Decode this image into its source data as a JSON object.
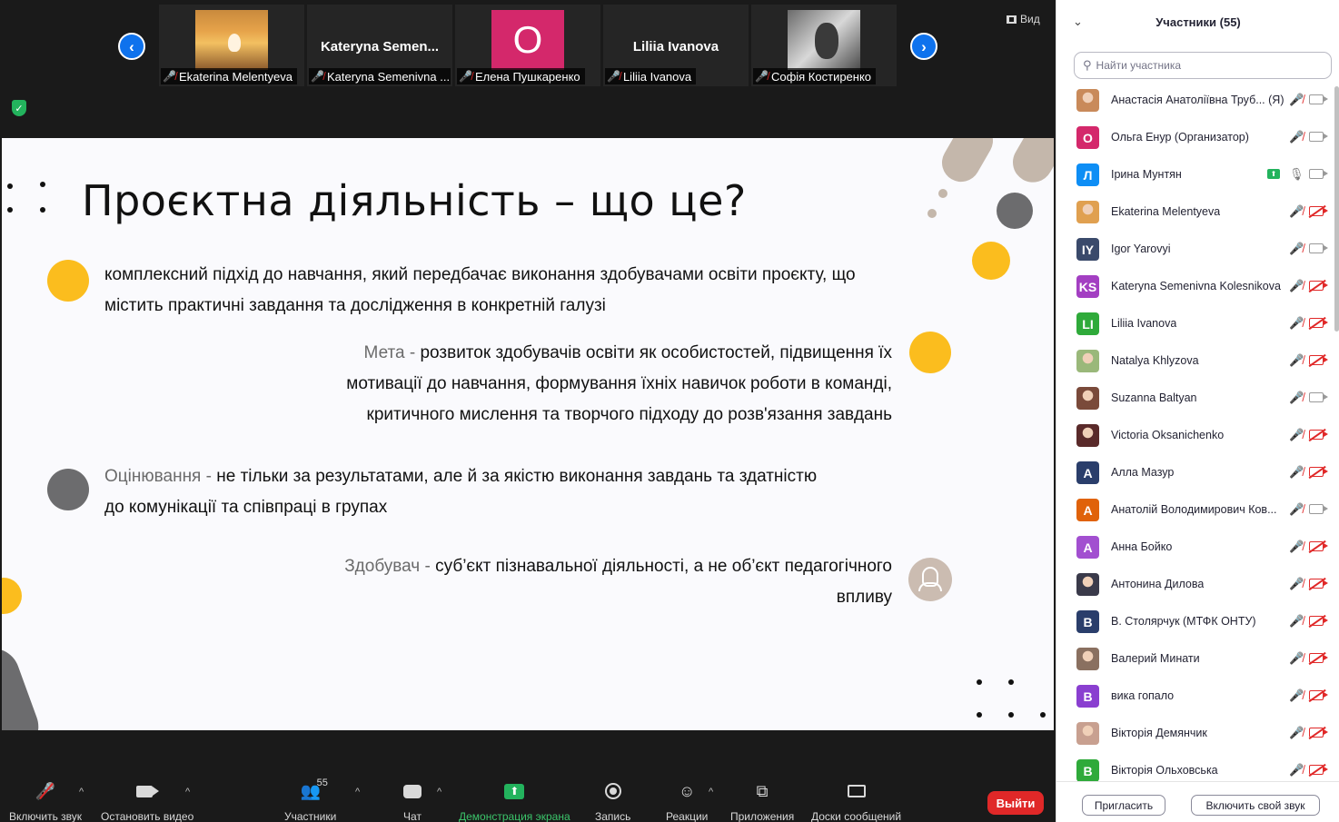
{
  "strip": {
    "view_label": "Вид",
    "thumbnails": [
      {
        "name": "",
        "label": "Ekaterina Melentyeva"
      },
      {
        "name": "Kateryna  Semen...",
        "label": "Kateryna Semenivna ..."
      },
      {
        "name": "",
        "label": "Елена Пушкаренко",
        "initial": "О"
      },
      {
        "name": "Liliia Ivanova",
        "label": "Liliia Ivanova"
      },
      {
        "name": "",
        "label": "Софія Костиренко"
      }
    ]
  },
  "slide": {
    "title": "Проєктна діяльність – що це?",
    "para1": "комплексний підхід до навчання, який передбачає виконання здобувачами освіти проєкту, що містить практичні завдання та дослідження в конкретній галузі",
    "para2_term": "Мета - ",
    "para2_text": "розвиток здобувачів освіти як особистостей, підвищення їх мотивації до навчання, формування їхніх навичок роботи в команді, критичного мислення та творчого підходу до розв'язання завдань",
    "para3_term": "Оцінювання - ",
    "para3_text": "не тільки за результатами, але й за якістю виконання завдань та здатністю до комунікації та співпраці в групах",
    "para4_term": "Здобувач - ",
    "para4_text": "суб’єкт пізнавальної діяльності, а не об’єкт педагогічного впливу"
  },
  "toolbar": {
    "unmute": "Включить звук",
    "stop_video": "Остановить видео",
    "participants": "Участники",
    "participants_count": "55",
    "chat": "Чат",
    "share": "Демонстрация экрана",
    "record": "Запись",
    "reactions": "Реакции",
    "apps": "Приложения",
    "whiteboards": "Доски сообщений",
    "leave": "Выйти"
  },
  "panel": {
    "title": "Участники (55)",
    "search_placeholder": "Найти участника",
    "invite": "Пригласить",
    "unmute_self": "Включить свой звук",
    "participants": [
      {
        "name": "Анастасія Анатоліївна Труб... (Я)",
        "initial": "",
        "color": "#c98a5a",
        "photo": true,
        "cam": "on",
        "mic": "off"
      },
      {
        "name": "Ольга Енур (Организатор)",
        "initial": "О",
        "color": "#d4286b",
        "photo": false,
        "cam": "on",
        "mic": "off"
      },
      {
        "name": "Ірина Мунтян",
        "initial": "Л",
        "color": "#0e8ef5",
        "photo": false,
        "cam": "on",
        "mic": "on",
        "share": true
      },
      {
        "name": "Ekaterina Melentyeva",
        "initial": "",
        "color": "#e0a050",
        "photo": true,
        "cam": "off",
        "mic": "off"
      },
      {
        "name": "Igor Yarovyi",
        "initial": "IY",
        "color": "#3a4a6b",
        "photo": false,
        "cam": "on",
        "mic": "off"
      },
      {
        "name": "Kateryna Semenivna Kolesnikova",
        "initial": "KS",
        "color": "#a33fc2",
        "photo": false,
        "cam": "off",
        "mic": "off"
      },
      {
        "name": "Liliia Ivanova",
        "initial": "LI",
        "color": "#2faa3a",
        "photo": false,
        "cam": "off",
        "mic": "off"
      },
      {
        "name": "Natalya Khlyzova",
        "initial": "",
        "color": "#9ab87a",
        "photo": true,
        "cam": "off",
        "mic": "off"
      },
      {
        "name": "Suzanna Baltyan",
        "initial": "",
        "color": "#7a4a3a",
        "photo": true,
        "cam": "on",
        "mic": "off"
      },
      {
        "name": "Victoria Oksanichenko",
        "initial": "",
        "color": "#5a2a2a",
        "photo": true,
        "cam": "off",
        "mic": "off"
      },
      {
        "name": "Алла Мазур",
        "initial": "А",
        "color": "#2a3e6b",
        "photo": false,
        "cam": "off",
        "mic": "off"
      },
      {
        "name": "Анатолій Володимирович Ков...",
        "initial": "А",
        "color": "#e0620a",
        "photo": false,
        "cam": "on",
        "mic": "off"
      },
      {
        "name": "Анна Бойко",
        "initial": "А",
        "color": "#a24fd0",
        "photo": false,
        "cam": "off",
        "mic": "off"
      },
      {
        "name": "Антонина Дилова",
        "initial": "",
        "color": "#3a3a4a",
        "photo": true,
        "cam": "off",
        "mic": "off"
      },
      {
        "name": "В. Столярчук (МТФК ОНТУ)",
        "initial": "В",
        "color": "#2a3e6b",
        "photo": false,
        "cam": "off",
        "mic": "off"
      },
      {
        "name": "Валерий Минати",
        "initial": "",
        "color": "#8a7060",
        "photo": true,
        "cam": "off",
        "mic": "off"
      },
      {
        "name": "вика гопало",
        "initial": "В",
        "color": "#8a3fd0",
        "photo": false,
        "cam": "off",
        "mic": "off"
      },
      {
        "name": "Вікторія Демянчик",
        "initial": "",
        "color": "#c8a090",
        "photo": true,
        "cam": "off",
        "mic": "off"
      },
      {
        "name": "Вікторія Ольховська",
        "initial": "В",
        "color": "#2faa3a",
        "photo": false,
        "cam": "off",
        "mic": "off"
      }
    ]
  },
  "colors": {
    "accent_blue": "#0e72ed",
    "yellow": "#fbbd1e",
    "danger": "#e02828",
    "share_green": "#23b35d"
  }
}
